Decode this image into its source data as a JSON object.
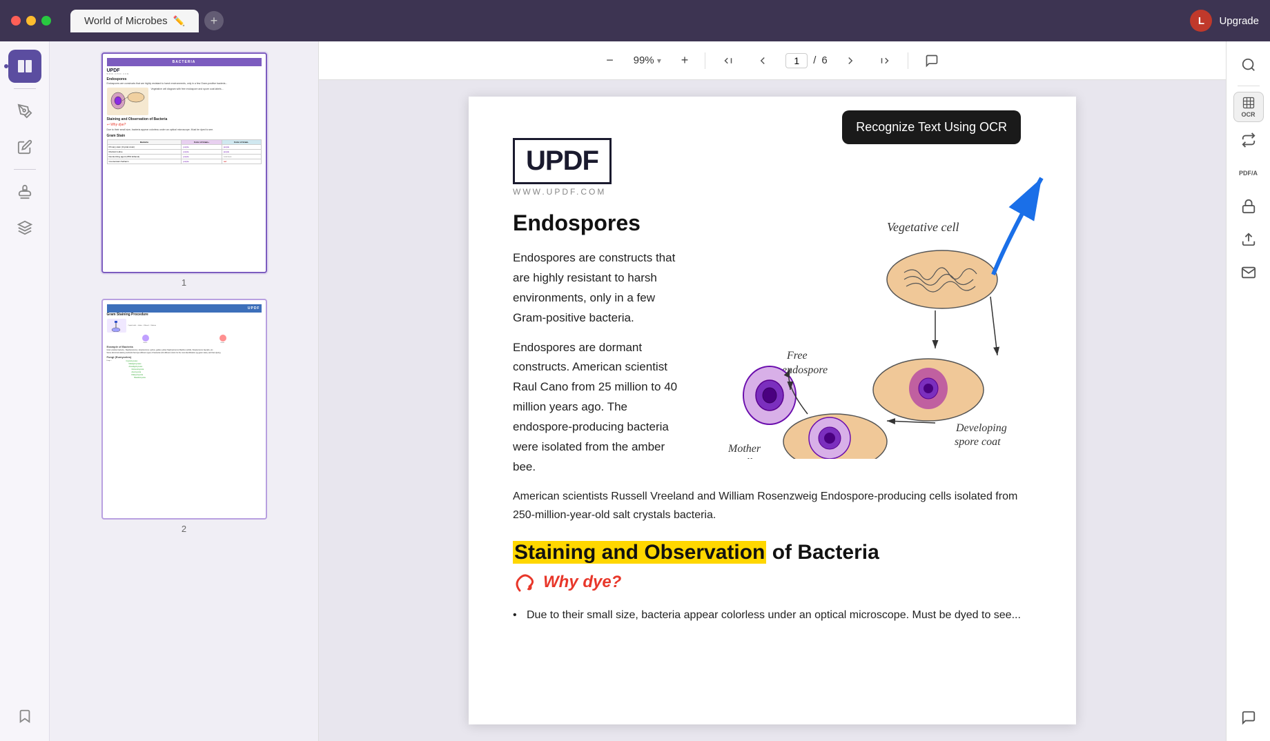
{
  "titlebar": {
    "traffic_lights": [
      "red",
      "yellow",
      "green"
    ],
    "tab_title": "World of Microbes",
    "edit_icon": "✏️",
    "new_tab": "+",
    "user_initial": "L",
    "upgrade_label": "Upgrade"
  },
  "toolbar": {
    "zoom_out": "−",
    "zoom_level": "99%",
    "zoom_in": "+",
    "nav_first": "⏮",
    "nav_prev": "⬆",
    "page_current": "1",
    "page_sep": "/",
    "page_total": "6",
    "nav_next": "⬇",
    "nav_last": "⏭",
    "comment": "💬"
  },
  "sidebar": {
    "icons": [
      {
        "name": "book-view-icon",
        "symbol": "⊞",
        "active": true
      },
      {
        "name": "pen-icon",
        "symbol": "✒"
      },
      {
        "name": "annotation-icon",
        "symbol": "📝"
      },
      {
        "name": "separator1"
      },
      {
        "name": "stamp-icon",
        "symbol": "🔖"
      },
      {
        "name": "layers-icon",
        "symbol": "⧉"
      },
      {
        "name": "separator2"
      },
      {
        "name": "bookmark-icon",
        "symbol": "🔖"
      }
    ]
  },
  "right_panel": {
    "icons": [
      {
        "name": "search-icon",
        "symbol": "🔍"
      },
      {
        "name": "separator1"
      },
      {
        "name": "ocr-icon",
        "symbol": "OCR",
        "label": "OCR"
      },
      {
        "name": "convert-icon",
        "symbol": "⟳"
      },
      {
        "name": "pdf-a-icon",
        "symbol": "PDF/A",
        "label": "PDF/A"
      },
      {
        "name": "protect-icon",
        "symbol": "🔒"
      },
      {
        "name": "share-icon",
        "symbol": "↑"
      },
      {
        "name": "email-icon",
        "symbol": "✉"
      },
      {
        "name": "spacer"
      },
      {
        "name": "chat-icon",
        "symbol": "💬"
      }
    ]
  },
  "ocr_tooltip": {
    "text": "Recognize Text Using OCR"
  },
  "document": {
    "updf_logo": "UPDF",
    "updf_logo_accent": "UPD",
    "updf_url": "WWW.UPDF.COM",
    "section1": {
      "title": "Endospores",
      "para1": "Endospores are constructs that are highly resistant to harsh environments, only in a few Gram-positive bacteria.",
      "para2": "Endospores are dormant constructs. American scientist Raul Cano from 25 million to 40 million years ago. The endospore-producing bacteria were isolated from the amber bee.",
      "para3": "American scientists Russell Vreeland and William Rosenzweig Endospore-producing cells isolated from 250-million-year-old salt crystals bacteria."
    },
    "diagram": {
      "vegetative_cell": "Vegetative cell",
      "free_endospore": "Free endospore",
      "spore_coat": "Spore coat",
      "developing_spore_coat": "Developing spore coat",
      "mother_cell": "Mother cell"
    },
    "section2": {
      "title_highlight": "Staining and Observation",
      "title_rest": " of Bacteria",
      "why_dye": "Why dye?",
      "bullet1": "Due to their small size, bacteria appear colorless under an optical microscope. Must be dyed to see..."
    }
  },
  "thumbnails": [
    {
      "page_num": "1"
    },
    {
      "page_num": "2"
    }
  ]
}
